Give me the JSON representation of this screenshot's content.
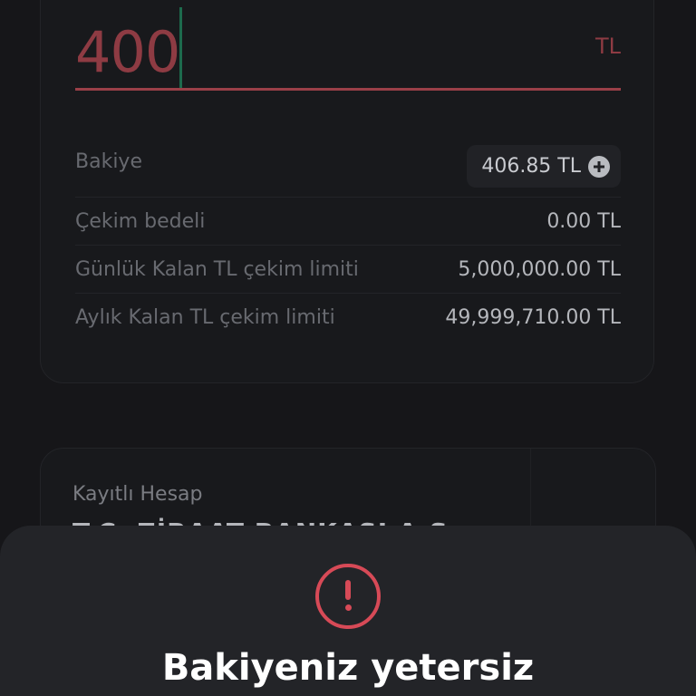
{
  "withdraw": {
    "amount": "400",
    "currency": "TL"
  },
  "info": {
    "balance_label": "Bakiye",
    "balance_value": "406.85 TL",
    "fee_label": "Çekim bedeli",
    "fee_value": "0.00 TL",
    "daily_label": "Günlük Kalan TL çekim limiti",
    "daily_value": "5,000,000.00 TL",
    "monthly_label": "Aylık Kalan TL çekim limiti",
    "monthly_value": "49,999,710.00 TL"
  },
  "account": {
    "label": "Kayıtlı Hesap",
    "name": "T.C. ZİRAAT BANKASI A.Ş."
  },
  "alert": {
    "title": "Bakiyeniz yetersiz"
  },
  "icons": {
    "add_balance": "plus-circle-icon",
    "alert": "exclamation-circle-icon"
  },
  "colors": {
    "error": "#d74a57",
    "caret": "#1d6b4d"
  }
}
